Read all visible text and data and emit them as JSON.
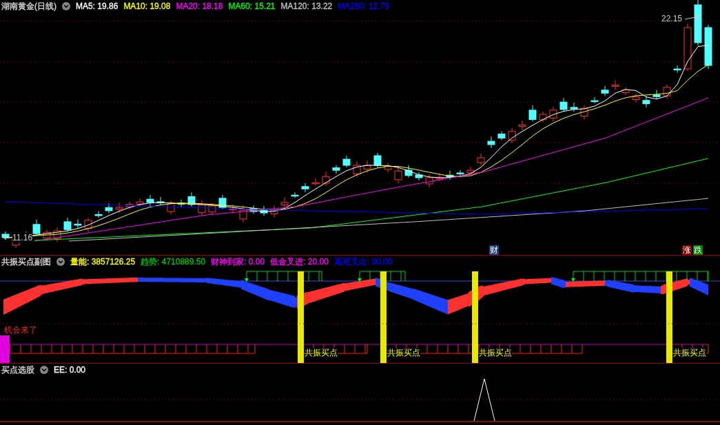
{
  "main_panel": {
    "title": "湖南黄金(日线)",
    "indicators": [
      {
        "label": "MA5: 19.86",
        "color": "#ffffff"
      },
      {
        "label": "MA10: 19.08",
        "color": "#ffff00"
      },
      {
        "label": "MA20: 18.18",
        "color": "#ff00ff"
      },
      {
        "label": "MA60: 15.21",
        "color": "#00ff00"
      },
      {
        "label": "MA120: 13.22",
        "color": "#c0c0c0"
      },
      {
        "label": "MA250: 12.75",
        "color": "#0000ff"
      }
    ],
    "high_label": "22.15",
    "low_label": "11.16",
    "markers": [
      {
        "text": "财",
        "color": "#1a3f7a"
      },
      {
        "text": "涨",
        "color": "#800000"
      },
      {
        "text": "跌",
        "color": "#008000"
      }
    ]
  },
  "sub_panel": {
    "title": "共振买点副图",
    "indicators": [
      {
        "label": "量能: 3857126.25",
        "color": "#ffff00"
      },
      {
        "label": "趋势: 4710889.50",
        "color": "#00c000"
      },
      {
        "label": "财神到家: 0.00",
        "color": "#ff00ff"
      },
      {
        "label": "低金叉进: 20.00",
        "color": "#ff00ff"
      },
      {
        "label": "高死叉出: 90.00",
        "color": "#0000ff"
      }
    ],
    "signal_label": "机会来了",
    "buy_labels": [
      "共振买点",
      "共振买点",
      "共振买点",
      "共振买点"
    ]
  },
  "bottom_panel": {
    "title": "买点选股",
    "indicators": [
      {
        "label": "EE: 0.00",
        "color": "#ffffff"
      }
    ]
  }
}
